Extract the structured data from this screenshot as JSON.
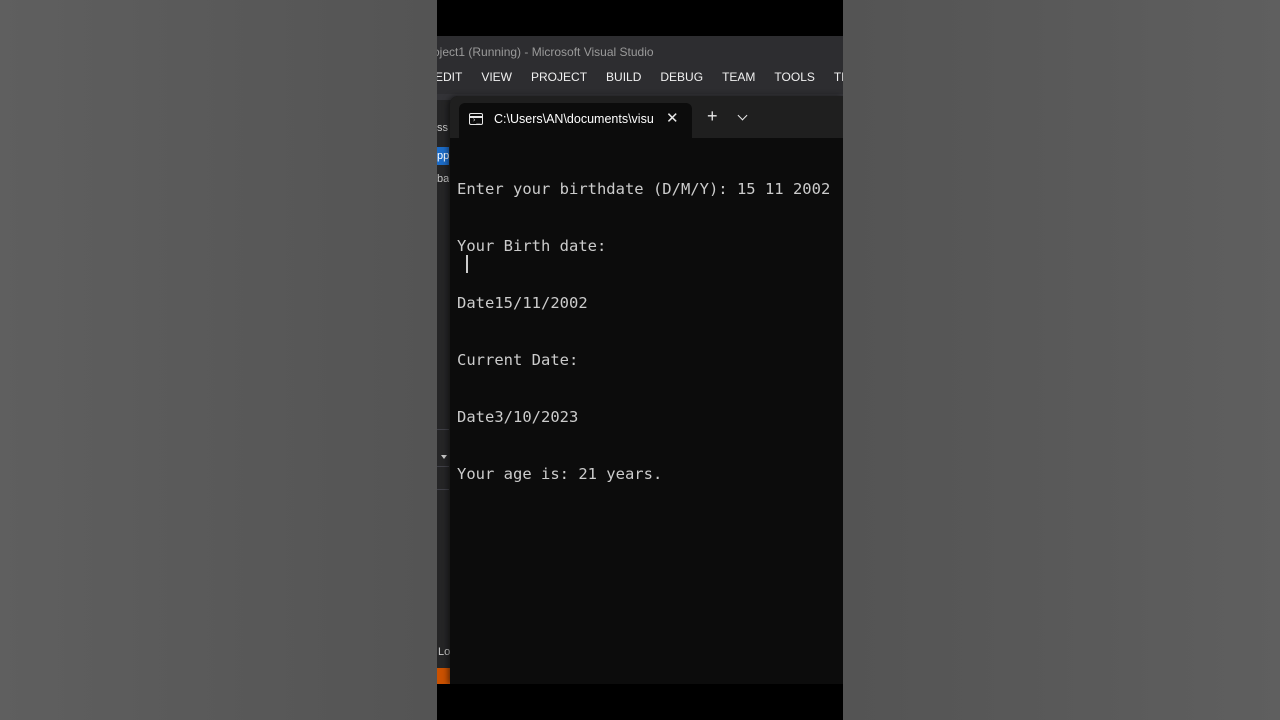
{
  "vs": {
    "title": "oject1 (Running) - Microsoft Visual Studio",
    "menu": [
      "EDIT",
      "VIEW",
      "PROJECT",
      "BUILD",
      "DEBUG",
      "TEAM",
      "TOOLS",
      "TEST"
    ],
    "left_fragments": {
      "ss": "ss:",
      "pp": "pp",
      "bal": "bal",
      "lo": "Lo"
    }
  },
  "terminal": {
    "tab_title": "C:\\Users\\AN\\documents\\visual",
    "lines": [
      "Enter your birthdate (D/M/Y): 15 11 2002",
      "Your Birth date:",
      "Date15/11/2002",
      "Current Date:",
      "Date3/10/2023",
      "Your age is: 21 years."
    ]
  },
  "icons": {
    "tab_icon": "terminal-icon",
    "close": "close-icon",
    "new_tab": "plus-icon",
    "dropdown": "chevron-down-icon"
  },
  "colors": {
    "terminal_bg": "#0c0c0c",
    "terminal_text": "#cccccc",
    "vs_status_accent": "#ca5100",
    "vs_selection": "#1c6bc6"
  }
}
